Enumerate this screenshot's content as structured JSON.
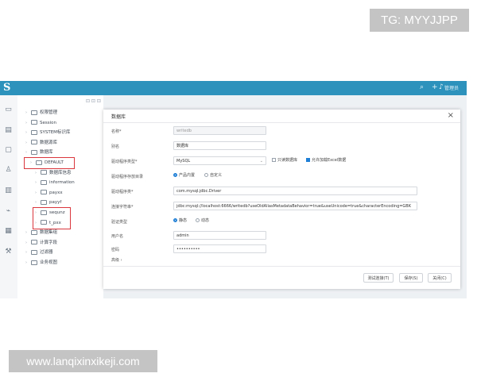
{
  "watermarks": {
    "top": "TG: MYYJJPP",
    "bottom": "www.lanqixinxikeji.com"
  },
  "app": {
    "logo": "S",
    "topbar_icons": [
      "search-icon",
      "plus-icon",
      "bell-icon"
    ],
    "user_label": "管理员",
    "tree_toolbar": "⊡ ⊡ ⊡",
    "tree": [
      {
        "label": "权限管理",
        "depth": 0
      },
      {
        "label": "Session",
        "depth": 0
      },
      {
        "label": "SYSTEM标识库",
        "depth": 0
      },
      {
        "label": "数据源库",
        "depth": 0
      },
      {
        "label": "数据库",
        "depth": 0
      },
      {
        "label": "DEFAULT",
        "depth": 1
      },
      {
        "label": "数据库信息",
        "depth": 2
      },
      {
        "label": "information",
        "depth": 2
      },
      {
        "label": "payxx",
        "depth": 2
      },
      {
        "label": "payyf",
        "depth": 2
      },
      {
        "label": "sequnz",
        "depth": 2
      },
      {
        "label": "t_pxx",
        "depth": 2
      },
      {
        "label": "数据集组",
        "depth": 0
      },
      {
        "label": "计算字段",
        "depth": 0
      },
      {
        "label": "过滤器",
        "depth": 0
      },
      {
        "label": "业务视图",
        "depth": 0
      }
    ]
  },
  "dialog": {
    "title": "数据库",
    "fields": {
      "name_label": "名称*",
      "name_value": "writedb",
      "alias_label": "别名",
      "alias_value": "数据库",
      "driver_type_label": "驱动程序类型*",
      "driver_type_value": "MySQL",
      "cb_readonly_label": "只读数据库",
      "cb_readonly_checked": false,
      "cb_excel_label": "允许加载Excel数据",
      "cb_excel_checked": true,
      "driver_source_label": "驱动程序存放目录",
      "driver_source_option1": "产品内置",
      "driver_source_option2": "自定义",
      "driver_label": "驱动程序类*",
      "driver_value": "com.mysql.jdbc.Driver",
      "conn_label": "连接字符串*",
      "conn_value": "jdbc:mysql://localhost:6666/writedb?useOldAliasMetadataBehavior=true&useUnicode=true&characterEncoding=GBK",
      "auth_label": "验证类型",
      "auth_option1": "静态",
      "auth_option2": "动态",
      "user_label": "用户名",
      "user_value": "admin",
      "password_label": "密码",
      "password_value": "••••••••••"
    },
    "advanced_label": "高级 ›",
    "buttons": {
      "test": "测试连接(T)",
      "save": "保存(S)",
      "close": "关闭(C)"
    }
  }
}
